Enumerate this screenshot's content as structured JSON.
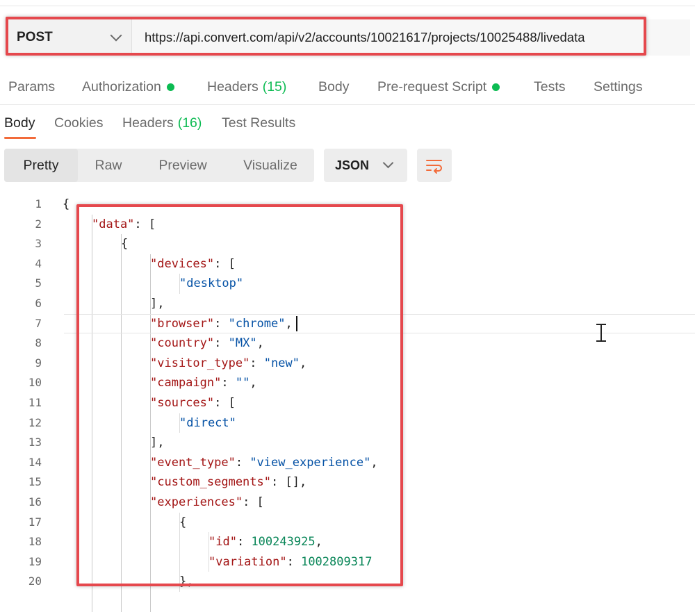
{
  "request": {
    "method": "POST",
    "url": "https://api.convert.com/api/v2/accounts/10021617/projects/10025488/livedata"
  },
  "request_tabs": [
    {
      "label": "Params"
    },
    {
      "label": "Authorization"
    },
    {
      "label": "Headers",
      "count": "(15)"
    },
    {
      "label": "Body"
    },
    {
      "label": "Pre-request Script"
    },
    {
      "label": "Tests"
    },
    {
      "label": "Settings"
    }
  ],
  "response_tabs": [
    {
      "label": "Body"
    },
    {
      "label": "Cookies"
    },
    {
      "label": "Headers",
      "count": "(16)"
    },
    {
      "label": "Test Results"
    }
  ],
  "view_modes": [
    "Pretty",
    "Raw",
    "Preview",
    "Visualize"
  ],
  "language": "JSON",
  "colors": {
    "accent": "#f26b3a",
    "status_dot": "#0cbb52",
    "highlight_box": "#e5484d",
    "json_key": "#a31515",
    "json_string": "#0451a5",
    "json_number": "#098658"
  },
  "code_lines": [
    {
      "n": "1",
      "indent": 0,
      "tokens": [
        {
          "t": "{",
          "c": "p"
        }
      ]
    },
    {
      "n": "2",
      "indent": 1,
      "tokens": [
        {
          "t": "\"data\"",
          "c": "k"
        },
        {
          "t": ": [",
          "c": "p"
        }
      ]
    },
    {
      "n": "3",
      "indent": 2,
      "tokens": [
        {
          "t": "{",
          "c": "p"
        }
      ]
    },
    {
      "n": "4",
      "indent": 3,
      "tokens": [
        {
          "t": "\"devices\"",
          "c": "k"
        },
        {
          "t": ": [",
          "c": "p"
        }
      ]
    },
    {
      "n": "5",
      "indent": 4,
      "tokens": [
        {
          "t": "\"desktop\"",
          "c": "s"
        }
      ]
    },
    {
      "n": "6",
      "indent": 3,
      "tokens": [
        {
          "t": "],",
          "c": "p"
        }
      ]
    },
    {
      "n": "7",
      "indent": 3,
      "tokens": [
        {
          "t": "\"browser\"",
          "c": "k"
        },
        {
          "t": ": ",
          "c": "p"
        },
        {
          "t": "\"chrome\"",
          "c": "s"
        },
        {
          "t": ",",
          "c": "p"
        }
      ]
    },
    {
      "n": "8",
      "indent": 3,
      "tokens": [
        {
          "t": "\"country\"",
          "c": "k"
        },
        {
          "t": ": ",
          "c": "p"
        },
        {
          "t": "\"MX\"",
          "c": "s"
        },
        {
          "t": ",",
          "c": "p"
        }
      ]
    },
    {
      "n": "9",
      "indent": 3,
      "tokens": [
        {
          "t": "\"visitor_type\"",
          "c": "k"
        },
        {
          "t": ": ",
          "c": "p"
        },
        {
          "t": "\"new\"",
          "c": "s"
        },
        {
          "t": ",",
          "c": "p"
        }
      ]
    },
    {
      "n": "10",
      "indent": 3,
      "tokens": [
        {
          "t": "\"campaign\"",
          "c": "k"
        },
        {
          "t": ": ",
          "c": "p"
        },
        {
          "t": "\"\"",
          "c": "s"
        },
        {
          "t": ",",
          "c": "p"
        }
      ]
    },
    {
      "n": "11",
      "indent": 3,
      "tokens": [
        {
          "t": "\"sources\"",
          "c": "k"
        },
        {
          "t": ": [",
          "c": "p"
        }
      ]
    },
    {
      "n": "12",
      "indent": 4,
      "tokens": [
        {
          "t": "\"direct\"",
          "c": "s"
        }
      ]
    },
    {
      "n": "13",
      "indent": 3,
      "tokens": [
        {
          "t": "],",
          "c": "p"
        }
      ]
    },
    {
      "n": "14",
      "indent": 3,
      "tokens": [
        {
          "t": "\"event_type\"",
          "c": "k"
        },
        {
          "t": ": ",
          "c": "p"
        },
        {
          "t": "\"view_experience\"",
          "c": "s"
        },
        {
          "t": ",",
          "c": "p"
        }
      ]
    },
    {
      "n": "15",
      "indent": 3,
      "tokens": [
        {
          "t": "\"custom_segments\"",
          "c": "k"
        },
        {
          "t": ": [],",
          "c": "p"
        }
      ]
    },
    {
      "n": "16",
      "indent": 3,
      "tokens": [
        {
          "t": "\"experiences\"",
          "c": "k"
        },
        {
          "t": ": [",
          "c": "p"
        }
      ]
    },
    {
      "n": "17",
      "indent": 4,
      "tokens": [
        {
          "t": "{",
          "c": "p"
        }
      ]
    },
    {
      "n": "18",
      "indent": 5,
      "tokens": [
        {
          "t": "\"id\"",
          "c": "k"
        },
        {
          "t": ": ",
          "c": "p"
        },
        {
          "t": "100243925",
          "c": "n"
        },
        {
          "t": ",",
          "c": "p"
        }
      ]
    },
    {
      "n": "19",
      "indent": 5,
      "tokens": [
        {
          "t": "\"variation\"",
          "c": "k"
        },
        {
          "t": ": ",
          "c": "p"
        },
        {
          "t": "1002809317",
          "c": "n"
        }
      ]
    },
    {
      "n": "20",
      "indent": 4,
      "tokens": [
        {
          "t": "},",
          "c": "p"
        }
      ]
    }
  ]
}
